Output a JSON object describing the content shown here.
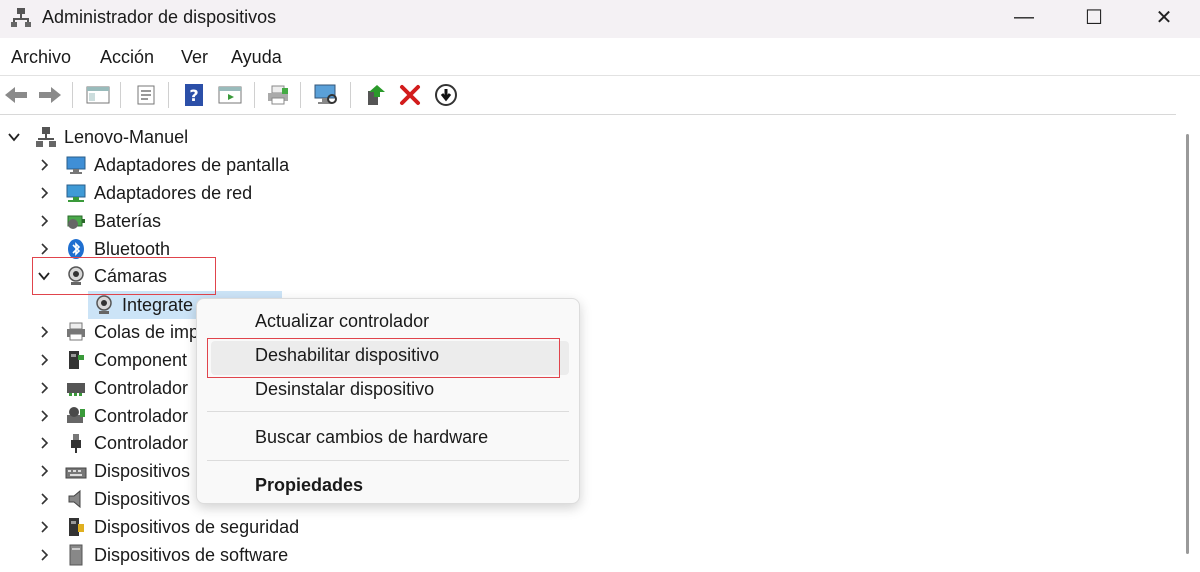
{
  "window": {
    "title": "Administrador de dispositivos",
    "minimize_glyph": "—",
    "maximize_glyph": "☐",
    "close_glyph": "✕"
  },
  "menubar": {
    "items": [
      {
        "label": "Archivo"
      },
      {
        "label": "Acción"
      },
      {
        "label": "Ver"
      },
      {
        "label": "Ayuda"
      }
    ]
  },
  "toolbar": {
    "icons": [
      "back-arrow-icon",
      "forward-arrow-icon",
      "show-hide-tree-icon",
      "properties-sheet-icon",
      "help-icon",
      "run-view-icon",
      "print-icon",
      "scan-hardware-icon",
      "update-driver-icon",
      "uninstall-icon",
      "disable-device-icon"
    ]
  },
  "tree": {
    "root": {
      "label": "Lenovo-Manuel",
      "icon": "computer-icon",
      "expanded": true
    },
    "items": [
      {
        "label": "Adaptadores de pantalla",
        "icon": "monitor-icon"
      },
      {
        "label": "Adaptadores de red",
        "icon": "network-adapter-icon"
      },
      {
        "label": "Baterías",
        "icon": "battery-icon"
      },
      {
        "label": "Bluetooth",
        "icon": "bluetooth-icon"
      },
      {
        "label": "Cámaras",
        "icon": "webcam-icon",
        "expanded": true
      },
      {
        "label": "Integrate",
        "icon": "webcam-icon",
        "child": true,
        "selected": true
      },
      {
        "label": "Colas de imp",
        "icon": "printer-icon"
      },
      {
        "label": "Component",
        "icon": "software-component-icon"
      },
      {
        "label": "Controlador",
        "icon": "storage-controller-icon"
      },
      {
        "label": "Controlador",
        "icon": "sound-controller-icon"
      },
      {
        "label": "Controlador",
        "icon": "usb-controller-icon"
      },
      {
        "label": "Dispositivos",
        "icon": "hid-device-icon"
      },
      {
        "label": "Dispositivos",
        "icon": "audio-device-icon"
      },
      {
        "label": "Dispositivos de seguridad",
        "icon": "security-device-icon"
      },
      {
        "label": "Dispositivos de software",
        "icon": "software-device-icon"
      }
    ]
  },
  "context_menu": {
    "items": [
      {
        "label": "Actualizar controlador"
      },
      {
        "label": "Deshabilitar dispositivo"
      },
      {
        "label": "Desinstalar dispositivo"
      },
      {
        "label": "Buscar cambios de hardware"
      },
      {
        "label": "Propiedades"
      }
    ]
  },
  "colors": {
    "highlight": "#e0444c",
    "selection": "#cce4f7",
    "titlebar": "#f4f1f4"
  }
}
